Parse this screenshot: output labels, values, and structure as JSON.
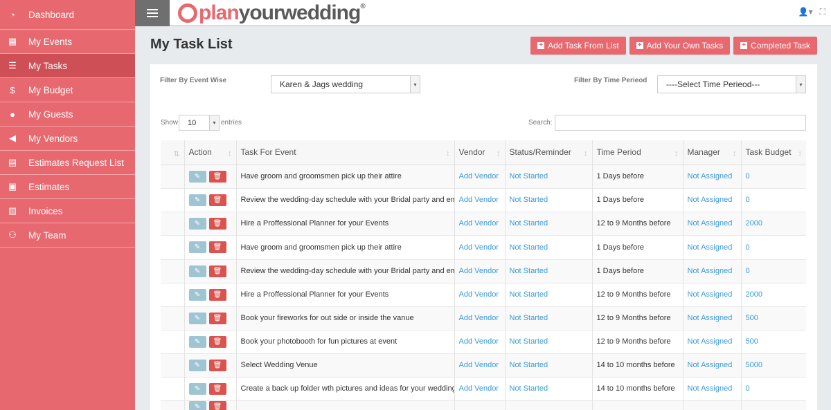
{
  "sidebar": {
    "items": [
      {
        "label": "Dashboard",
        "icon": "dashboard-icon",
        "glyph": "◔"
      },
      {
        "label": "My Events",
        "icon": "calendar-icon",
        "glyph": "▦"
      },
      {
        "label": "My Tasks",
        "icon": "tasks-list-icon",
        "glyph": "☰"
      },
      {
        "label": "My Budget",
        "icon": "dollar-icon",
        "glyph": "$"
      },
      {
        "label": "My Guests",
        "icon": "user-icon",
        "glyph": "●"
      },
      {
        "label": "My Vendors",
        "icon": "megaphone-icon",
        "glyph": "◀"
      },
      {
        "label": "Estimates Request List",
        "icon": "clipboard-icon",
        "glyph": "▤"
      },
      {
        "label": "Estimates",
        "icon": "clipboard-check-icon",
        "glyph": "▣"
      },
      {
        "label": "Invoices",
        "icon": "invoice-icon",
        "glyph": "▥"
      },
      {
        "label": "My Team",
        "icon": "team-icon",
        "glyph": "⚇"
      }
    ],
    "active_index": 2
  },
  "header": {
    "logo_plan": "plan",
    "logo_rest": "yourwedding",
    "logo_reg": "®",
    "user_glyph": "👤▾",
    "expand_glyph": "⛶"
  },
  "page": {
    "title": "My Task List",
    "buttons": {
      "add_from_list": "Add Task From List",
      "add_own": "Add Your Own Tasks",
      "completed": "Completed Task"
    }
  },
  "filters": {
    "event_label": "Filter By Event Wise",
    "event_value": "Karen & Jags wedding",
    "time_label": "Filter By Time Perieod",
    "time_value": "----Select Time Perieod---"
  },
  "table_controls": {
    "show_label": "Show",
    "entries_value": "10",
    "entries_label": "entries",
    "search_label": "Search:"
  },
  "table": {
    "columns": [
      "",
      "Action",
      "Task For Event",
      "Vendor",
      "Status/Reminder",
      "Time Period",
      "Manager",
      "Task Budget"
    ],
    "rows": [
      {
        "task": "Have groom and groomsmen pick up their attire",
        "vendor": "Add Vendor",
        "status": "Not Started",
        "period": "1 Days before",
        "manager": "Not Assigned",
        "budget": "0"
      },
      {
        "task": "Review the wedding-day schedule with your Bridal party and emcee",
        "vendor": "Add Vendor",
        "status": "Not Started",
        "period": "1 Days before",
        "manager": "Not Assigned",
        "budget": "0"
      },
      {
        "task": "Hire a Proffessional Planner for your Events",
        "vendor": "Add Vendor",
        "status": "Not Started",
        "period": "12 to 9 Months before",
        "manager": "Not Assigned",
        "budget": "2000"
      },
      {
        "task": "Have groom and groomsmen pick up their attire",
        "vendor": "Add Vendor",
        "status": "Not Started",
        "period": "1 Days before",
        "manager": "Not Assigned",
        "budget": "0"
      },
      {
        "task": "Review the wedding-day schedule with your Bridal party and emcee",
        "vendor": "Add Vendor",
        "status": "Not Started",
        "period": "1 Days before",
        "manager": "Not Assigned",
        "budget": "0"
      },
      {
        "task": "Hire a Proffessional Planner for your Events",
        "vendor": "Add Vendor",
        "status": "Not Started",
        "period": "12 to 9 Months before",
        "manager": "Not Assigned",
        "budget": "2000"
      },
      {
        "task": "Book your fireworks for out side or inside the vanue",
        "vendor": "Add Vendor",
        "status": "Not Started",
        "period": "12 to 9 Months before",
        "manager": "Not Assigned",
        "budget": "500"
      },
      {
        "task": "Book your photobooth for fun pictures  at event",
        "vendor": "Add Vendor",
        "status": "Not Started",
        "period": "12 to 9 Months before",
        "manager": "Not Assigned",
        "budget": "500"
      },
      {
        "task": "Select Wedding Venue",
        "vendor": "Add Vendor",
        "status": "Not Started",
        "period": "14 to 10 months before",
        "manager": "Not Assigned",
        "budget": "5000"
      },
      {
        "task": "Create a back up folder wth pictures and ideas for your wedding",
        "vendor": "Add Vendor",
        "status": "Not Started",
        "period": "14 to 10 months before",
        "manager": "Not Assigned",
        "budget": "0"
      },
      {
        "task": "",
        "vendor": "",
        "status": "",
        "period": "",
        "manager": "",
        "budget": ""
      }
    ]
  },
  "colors": {
    "sidebar": "#e8686f",
    "sidebar_active": "#cf4f57",
    "accent_button": "#e8686f",
    "link": "#3a9ad9",
    "delete_button": "#d9534f",
    "edit_button": "#9fc5d3"
  }
}
